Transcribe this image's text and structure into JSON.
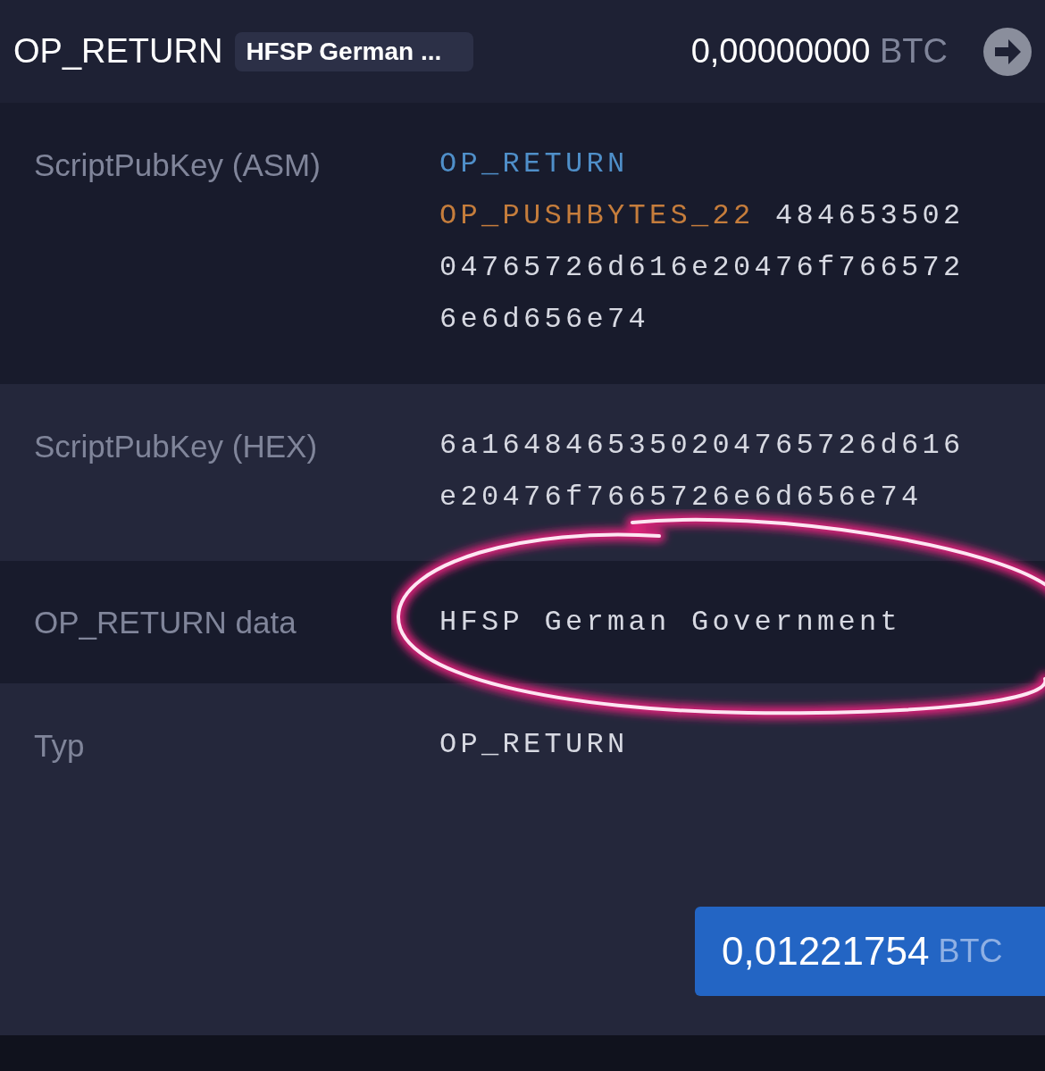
{
  "output": {
    "type": "OP_RETURN",
    "badge": "HFSP German ...",
    "amount": "0,00000000",
    "unit": "BTC"
  },
  "details": [
    {
      "label": "ScriptPubKey (ASM)",
      "kind": "tokens",
      "tokens": [
        {
          "kind": "opcode",
          "text": "OP_RETURN"
        },
        {
          "kind": "push",
          "text": "OP_PUSHBYTES_22"
        },
        {
          "kind": "data",
          "text": "48465350204765726d616e20476f7665726e6d656e74"
        }
      ]
    },
    {
      "label": "ScriptPubKey (HEX)",
      "kind": "text",
      "value": "6a1648465350204765726d616e20476f7665726e6d656e74"
    },
    {
      "label": "OP_RETURN data",
      "kind": "text",
      "value": "HFSP German Government"
    },
    {
      "label": "Typ",
      "kind": "text",
      "value": "OP_RETURN"
    }
  ],
  "total": {
    "amount": "0,01221754",
    "unit": "BTC"
  }
}
